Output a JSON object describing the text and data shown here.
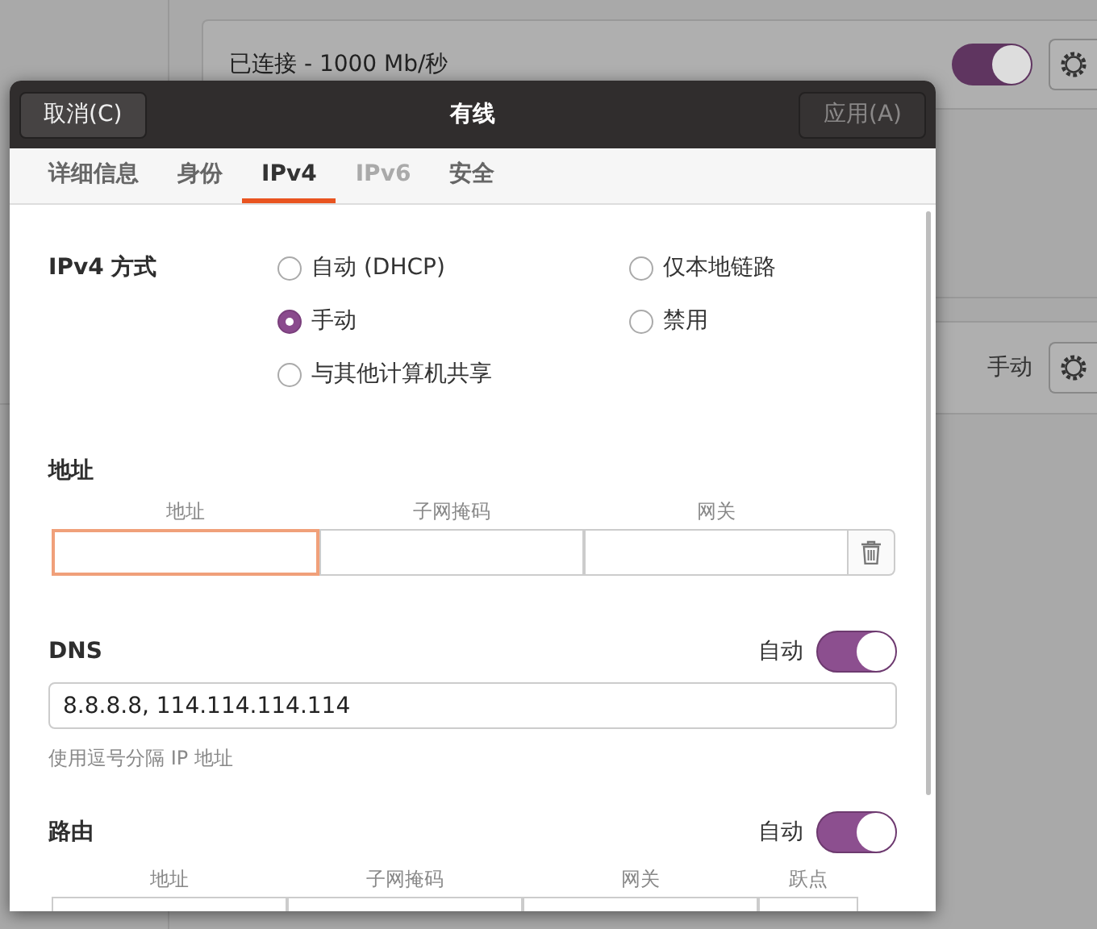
{
  "background": {
    "connection": {
      "status": "已连接 - 1000 Mb/秒",
      "on": true
    },
    "method_row": {
      "value": "手动"
    }
  },
  "dialog": {
    "title": "有线",
    "cancel": "取消(C)",
    "apply": {
      "label": "应用(A)",
      "disabled": true
    }
  },
  "tabs": [
    {
      "label": "详细信息",
      "selected": false,
      "disabled": false
    },
    {
      "label": "身份",
      "selected": false,
      "disabled": false
    },
    {
      "label": "IPv4",
      "selected": true,
      "disabled": false
    },
    {
      "label": "IPv6",
      "selected": false,
      "disabled": true
    },
    {
      "label": "安全",
      "selected": false,
      "disabled": false
    }
  ],
  "ipv4_method": {
    "label": "IPv4 方式",
    "options": [
      {
        "label": "自动 (DHCP)",
        "selected": false
      },
      {
        "label": "仅本地链路",
        "selected": false
      },
      {
        "label": "手动",
        "selected": true
      },
      {
        "label": "禁用",
        "selected": false
      },
      {
        "label": "与其他计算机共享",
        "selected": false
      }
    ]
  },
  "addresses": {
    "title": "地址",
    "columns": [
      "地址",
      "子网掩码",
      "网关"
    ],
    "fields": [
      {
        "focused": true
      },
      {
        "focused": false
      },
      {
        "focused": false
      }
    ]
  },
  "dns": {
    "title": "DNS",
    "auto_label": "自动",
    "auto": true,
    "value": "8.8.8.8, 114.114.114.114",
    "hint": "使用逗号分隔 IP 地址"
  },
  "routes": {
    "title": "路由",
    "auto_label": "自动",
    "auto": true,
    "columns": [
      "地址",
      "子网掩码",
      "网关",
      "跃点"
    ]
  }
}
